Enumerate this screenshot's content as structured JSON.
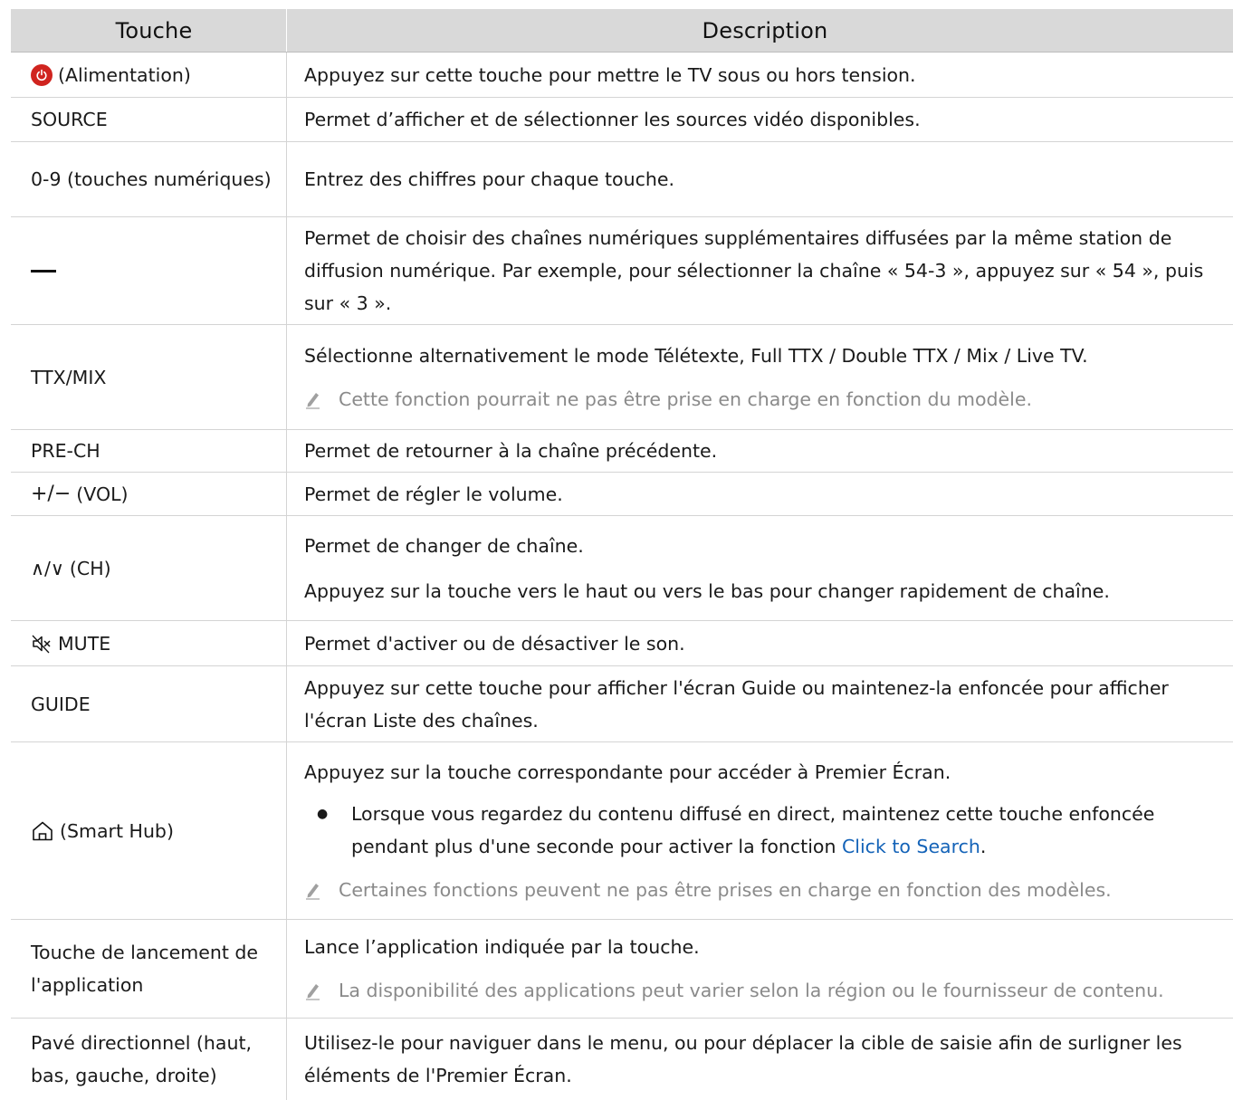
{
  "header": {
    "col1": "Touche",
    "col2": "Description"
  },
  "rows": [
    {
      "key": "(Alimentation)",
      "icon": "power-icon",
      "desc": "Appuyez sur cette touche pour mettre le TV sous ou hors tension."
    },
    {
      "key": "SOURCE",
      "desc": "Permet d’afficher et de sélectionner les sources vidéo disponibles."
    },
    {
      "key": "0-9 (touches numériques)",
      "desc": "Entrez des chiffres pour chaque touche."
    },
    {
      "key": "",
      "icon": "dash-icon",
      "desc": "Permet de choisir des chaînes numériques supplémentaires diffusées par la même station de diffusion numérique. Par exemple, pour sélectionner la chaîne « 54-3 », appuyez sur « 54 », puis sur « 3 »."
    },
    {
      "key": "TTX/MIX",
      "desc": "Sélectionne alternativement le mode Télétexte, Full TTX / Double TTX / Mix / Live TV.",
      "note": "Cette fonction pourrait ne pas être prise en charge en fonction du modèle."
    },
    {
      "key": "PRE-CH",
      "desc": "Permet de retourner à la chaîne précédente."
    },
    {
      "key": "(VOL)",
      "symbol": "+/−",
      "desc": "Permet de régler le volume."
    },
    {
      "key": "(CH)",
      "symbol": "∧/∨",
      "desc": "Permet de changer de chaîne.",
      "desc2": "Appuyez sur la touche vers le haut ou vers le bas pour changer rapidement de chaîne."
    },
    {
      "key": "MUTE",
      "icon": "mute-icon",
      "desc": "Permet d'activer ou de désactiver le son."
    },
    {
      "key": "GUIDE",
      "desc": "Appuyez sur cette touche pour afficher l'écran Guide ou maintenez-la enfoncée pour afficher l'écran Liste des chaînes."
    },
    {
      "key": "(Smart Hub)",
      "icon": "home-icon",
      "desc": "Appuyez sur la touche correspondante pour accéder à Premier Écran.",
      "bullet": "Lorsque vous regardez du contenu diffusé en direct, maintenez cette touche enfoncée pendant plus d'une seconde pour activer la fonction ",
      "bullet_link": "Click to Search",
      "bullet_end": ".",
      "note": "Certaines fonctions peuvent ne pas être prises en charge en fonction des modèles."
    },
    {
      "key": "Touche de lancement de l'application",
      "desc": "Lance l’application indiquée par la touche.",
      "note": "La disponibilité des applications peut varier selon la région ou le fournisseur de contenu."
    },
    {
      "key": "Pavé directionnel (haut, bas, gauche, droite)",
      "desc": "Utilisez-le pour naviguer dans le menu, ou pour déplacer la cible de saisie afin de surligner les éléments de l'Premier Écran."
    }
  ]
}
